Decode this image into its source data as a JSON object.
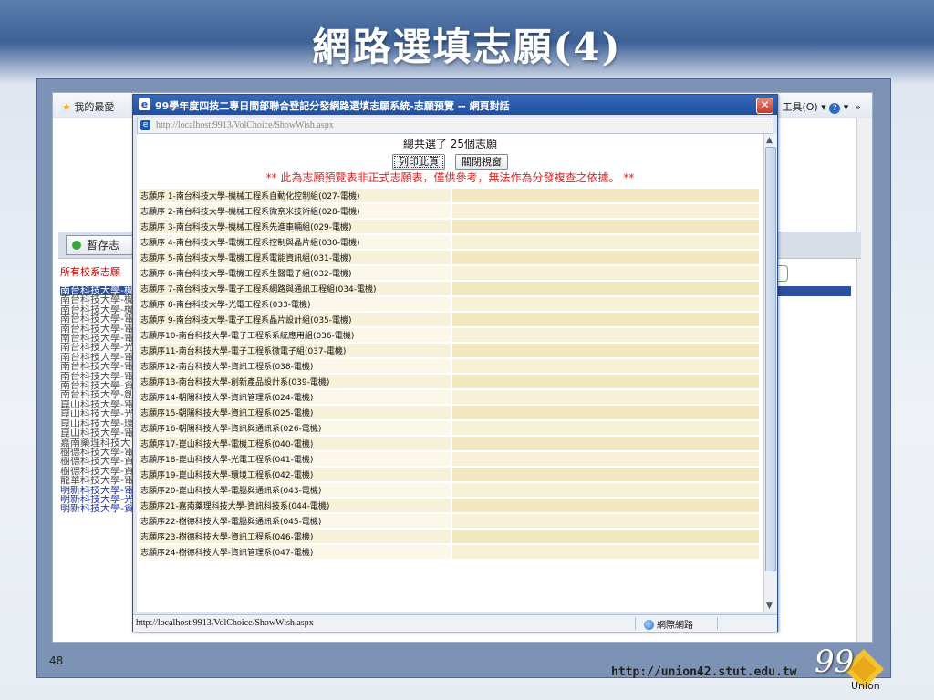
{
  "slide": {
    "title": "網路選填志願(4)",
    "page_number": "48",
    "footer_url": "http://union42.stut.edu.tw",
    "logo_number": "99",
    "logo_text": "Union"
  },
  "background_browser": {
    "favorites_label": "我的最愛",
    "tools_label": "工具(O)",
    "save_button": "暫存志",
    "all_label": "所有校系志願",
    "list_items": [
      "南台科技大學-機",
      "南台科技大學-機",
      "南台科技大學-機",
      "南台科技大學-電",
      "南台科技大學-電",
      "南台科技大學-電",
      "南台科技大學-光",
      "南台科技大學-電",
      "南台科技大學-電",
      "南台科技大學-電",
      "南台科技大學-資",
      "南台科技大學-創",
      "崑山科技大學-電",
      "崑山科技大學-光",
      "崑山科技大學-環",
      "崑山科技大學-電",
      "嘉南藥理科技大",
      "樹德科技大學-電",
      "樹德科技大學-資",
      "樹德科技大學-資",
      "龍華科技大學-電",
      "明新科技大學-電",
      "明新科技大學-光",
      "明新科技大學-資"
    ]
  },
  "dialog": {
    "title": "99學年度四技二專日間部聯合登記分發網路選填志願系統-志願預覽 -- 網頁對話",
    "address": "http://localhost:9913/VolChoice/ShowWish.aspx",
    "summary": "總共選了 25個志願",
    "print_button": "列印此頁",
    "close_button": "關閉視窗",
    "notice": "** 此為志願預覽表非正式志願表，僅供參考，無法作為分發複查之依據。 **",
    "status_url": "http://localhost:9913/VolChoice/ShowWish.aspx",
    "status_zone": "網際網路",
    "wishes": [
      "志願序 1-南台科技大學-機械工程系自動化控制組(027-電機)",
      "志願序 2-南台科技大學-機械工程系微奈米技術組(028-電機)",
      "志願序 3-南台科技大學-機械工程系先進車輛組(029-電機)",
      "志願序 4-南台科技大學-電機工程系控制與晶片組(030-電機)",
      "志願序 5-南台科技大學-電機工程系電能資訊組(031-電機)",
      "志願序 6-南台科技大學-電機工程系生醫電子組(032-電機)",
      "志願序 7-南台科技大學-電子工程系網路與通訊工程組(034-電機)",
      "志願序 8-南台科技大學-光電工程系(033-電機)",
      "志願序 9-南台科技大學-電子工程系晶片設計組(035-電機)",
      "志願序10-南台科技大學-電子工程系系統應用組(036-電機)",
      "志願序11-南台科技大學-電子工程系微電子組(037-電機)",
      "志願序12-南台科技大學-資訊工程系(038-電機)",
      "志願序13-南台科技大學-創新產品設計系(039-電機)",
      "志願序14-朝陽科技大學-資訊管理系(024-電機)",
      "志願序15-朝陽科技大學-資訊工程系(025-電機)",
      "志願序16-朝陽科技大學-資訊與通訊系(026-電機)",
      "志願序17-崑山科技大學-電機工程系(040-電機)",
      "志願序18-崑山科技大學-光電工程系(041-電機)",
      "志願序19-崑山科技大學-環境工程系(042-電機)",
      "志願序20-崑山科技大學-電腦與通訊系(043-電機)",
      "志願序21-嘉南藥理科技大學-資訊科技系(044-電機)",
      "志願序22-樹德科技大學-電腦與通訊系(045-電機)",
      "志願序23-樹德科技大學-資訊工程系(046-電機)",
      "志願序24-樹德科技大學-資訊管理系(047-電機)"
    ]
  }
}
